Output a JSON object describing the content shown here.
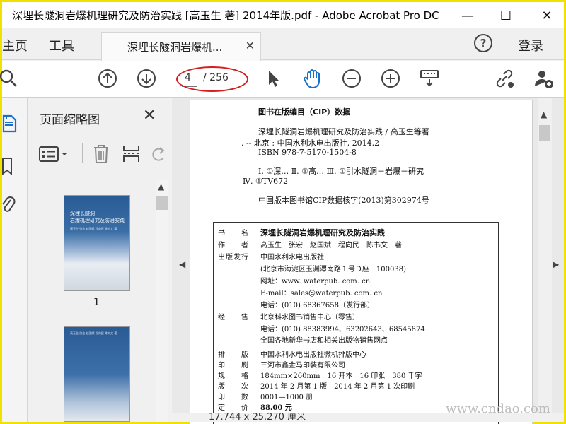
{
  "window": {
    "title": "深埋长隧洞岩爆机理研究及防治实践 [高玉生 著] 2014年版.pdf - Adobe Acrobat Pro DC",
    "minimize": "—",
    "maximize": "☐",
    "close": "✕"
  },
  "menu": {
    "home": "主页",
    "tools": "工具",
    "doc_tab": "深埋长隧洞岩爆机...",
    "doc_tab_close": "✕",
    "help": "?",
    "login": "登录"
  },
  "toolbar": {
    "current_page": "4",
    "total_pages": "/ 256"
  },
  "thumbnails": {
    "title": "页面缩略图",
    "close": "✕",
    "page1_label": "1",
    "thumb1_title": "深埋长隧洞\n岩爆机理研究及防治实践",
    "thumb1_authors": "高玉生 张宏 赵国斌 程向民 陈书文 著",
    "thumb2_authors": "高玉生 张宏 赵国斌 程向民 陈书文 著"
  },
  "document": {
    "cip_heading": "图书在版编目（CIP）数据",
    "cip_lines": [
      "深埋长隧洞岩爆机理研究及防治实践 / 高玉生等著",
      ". -- 北京 : 中国水利水电出版社, 2014.2",
      "ISBN 978-7-5170-1504-8",
      "Ⅰ. ①深… Ⅱ. ①高… Ⅲ. ①引水隧洞－岩爆－研究",
      "Ⅳ. ①TV672",
      "中国版本图书馆CIP数据核字(2013)第302974号"
    ],
    "info": {
      "k_title": "书　　名",
      "v_title": "深埋长隧洞岩爆机理研究及防治实践",
      "k_author": "作　　者",
      "v_author": "高玉生　张宏　赵国斌　程向民　陈书文　著",
      "k_publisher": "出版发行",
      "v_publisher": "中国水利水电出版社",
      "v_address": "(北京市海淀区玉渊潭南路１号Ｄ座　100038)",
      "v_web": "网址：www. waterpub. com. cn",
      "v_email": "E-mail：sales@waterpub. com. cn",
      "v_phone": "电话：(010) 68367658（发行部）",
      "k_seller": "经　　售",
      "v_seller": "北京科水图书销售中心（零售）",
      "v_seller_phone": "电话：(010) 88383994、63202643、68545874",
      "v_seller_net": "全国各地新华书店和相关出版物销售网点",
      "k_layout": "排　　版",
      "v_layout": "中国水利水电出版社微机排版中心",
      "k_print": "印　　刷",
      "v_print": "三河市鑫金马印装有限公司",
      "k_spec": "规　　格",
      "v_spec": "184mm×260mm　16 开本　16 印张　380 千字",
      "k_edition": "版　　次",
      "v_edition": "2014 年 2 月第 1 版　2014 年 2 月第 1 次印刷",
      "k_copies": "印　　数",
      "v_copies": "0001—1000 册",
      "k_price": "定　　价",
      "v_price": "88.00 元"
    }
  },
  "status": {
    "page_size": "17.744 x 25.270 厘米"
  },
  "watermark": "www.cndao.com",
  "colors": {
    "highlight_ellipse": "#d51e1e",
    "frame_border": "#f2e100"
  }
}
